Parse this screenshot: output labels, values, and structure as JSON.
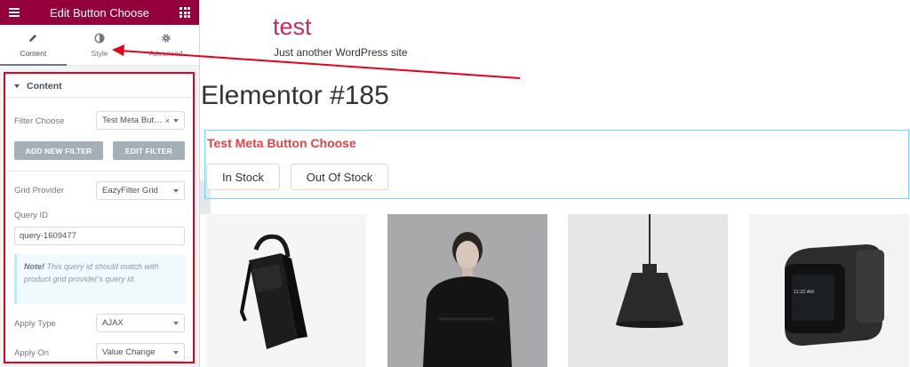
{
  "panel": {
    "title": "Edit Button Choose",
    "tabs": [
      {
        "label": "Content",
        "icon": "pencil-icon"
      },
      {
        "label": "Style",
        "icon": "half-circle-icon"
      },
      {
        "label": "Advanced",
        "icon": "gear-icon"
      }
    ],
    "section_title": "Content",
    "filter_choose": {
      "label": "Filter Choose",
      "value": "Test Meta Butt…"
    },
    "add_new_filter": "ADD NEW FILTER",
    "edit_filter": "EDIT FILTER",
    "grid_provider": {
      "label": "Grid Provider",
      "value": "EazyFilter Grid"
    },
    "query_id": {
      "label": "Query ID",
      "value": "query-1609477"
    },
    "note": {
      "strong": "Note!",
      "text": " This query id should match with product grid provider's query id."
    },
    "apply_type": {
      "label": "Apply Type",
      "value": "AJAX"
    },
    "apply_on": {
      "label": "Apply On",
      "value": "Value Change"
    }
  },
  "site": {
    "title": "test",
    "tagline": "Just another WordPress site"
  },
  "page": {
    "title": "Elementor #185"
  },
  "widget": {
    "title": "Test Meta Button Choose",
    "buttons": [
      "In Stock",
      "Out Of Stock"
    ]
  },
  "products": [
    {
      "name": "backpack",
      "bg": "#f5f5f5"
    },
    {
      "name": "jacket-model",
      "bg": "#a6a6a8"
    },
    {
      "name": "pendant-lamp",
      "bg": "#e6e6e6"
    },
    {
      "name": "fitness-tracker",
      "bg": "#f3f3f3"
    }
  ],
  "colors": {
    "panel_header": "#93003c",
    "site_title": "#c32b5e",
    "widget_title": "#e04545",
    "annotation": "#e1001e",
    "widget_border": "#71d7f7"
  },
  "watch_time": "11:22 AM"
}
